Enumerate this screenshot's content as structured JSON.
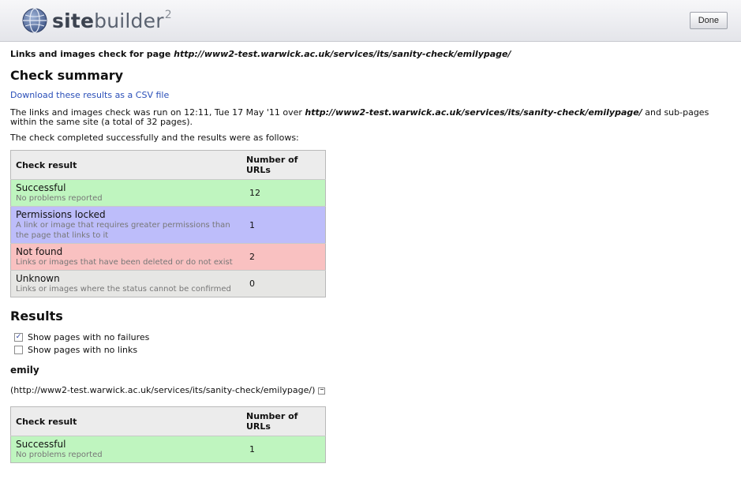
{
  "header": {
    "logo_bold": "site",
    "logo_light": "builder",
    "logo_sup": "2",
    "done_label": "Done"
  },
  "page": {
    "title_prefix": "Links and images check for page ",
    "title_url": "http://www2-test.warwick.ac.uk/services/its/sanity-check/emilypage/",
    "summary_heading": "Check summary",
    "csv_link": "Download these results as a CSV file",
    "run_text_1": "The links and images check was run on 12:11, Tue 17 May '11 over ",
    "run_url": "http://www2-test.warwick.ac.uk/services/its/sanity-check/emilypage/",
    "run_text_2": " and sub-pages within the same site (a total of 32 pages).",
    "completed_text": "The check completed successfully and the results were as follows:"
  },
  "summary_table": {
    "col_result": "Check result",
    "col_count": "Number of URLs",
    "rows": [
      {
        "name": "Successful",
        "desc": "No problems reported",
        "count": "12"
      },
      {
        "name": "Permissions locked",
        "desc": "A link or image that requires greater permissions than the page that links to it",
        "count": "1"
      },
      {
        "name": "Not found",
        "desc": "Links or images that have been deleted or do not exist",
        "count": "2"
      },
      {
        "name": "Unknown",
        "desc": "Links or images where the status cannot be confirmed",
        "count": "0"
      }
    ]
  },
  "results": {
    "heading": "Results",
    "opt_no_failures": "Show pages with no failures",
    "opt_no_failures_checked": "✓",
    "opt_no_links": "Show pages with no links",
    "page_name": "emily",
    "page_url": "(http://www2-test.warwick.ac.uk/services/its/sanity-check/emilypage/)"
  },
  "page_table": {
    "col_result": "Check result",
    "col_count": "Number of URLs",
    "rows": [
      {
        "name": "Successful",
        "desc": "No problems reported",
        "count": "1"
      }
    ]
  },
  "colors": {
    "successful": "#bff5bf",
    "permissions_locked": "#bdbdfa",
    "not_found": "#f9c1c1",
    "unknown": "#e6e6e4",
    "link": "#2a4fb8"
  }
}
